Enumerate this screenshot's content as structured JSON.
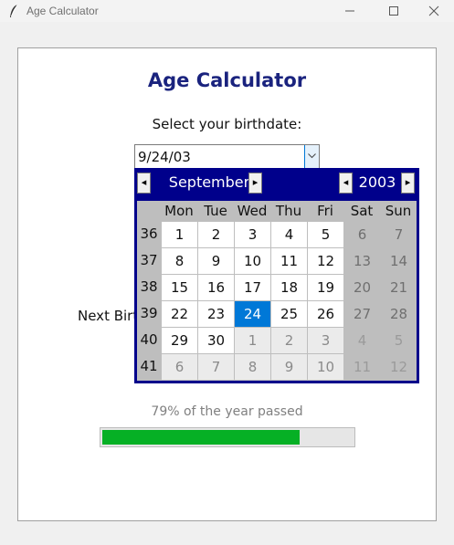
{
  "window": {
    "title": "Age Calculator",
    "app_icon": "feather-icon",
    "controls": [
      "minimize-icon",
      "maximize-icon",
      "close-icon"
    ]
  },
  "heading": "Age Calculator",
  "select_label": "Select your birthdate:",
  "date_entry": {
    "value": "9/24/03",
    "dropdown_icon": "chevron-down-icon"
  },
  "next_birthday_label": "Next Birth",
  "calendar": {
    "month": "September",
    "year": "2003",
    "prev_month": "◂",
    "next_month": "▸",
    "prev_year": "◂",
    "next_year": "▸",
    "weekdays": [
      "Mon",
      "Tue",
      "Wed",
      "Thu",
      "Fri",
      "Sat",
      "Sun"
    ],
    "weeks": [
      {
        "num": "36",
        "days": [
          "1",
          "2",
          "3",
          "4",
          "5",
          "6",
          "7"
        ]
      },
      {
        "num": "37",
        "days": [
          "8",
          "9",
          "10",
          "11",
          "12",
          "13",
          "14"
        ]
      },
      {
        "num": "38",
        "days": [
          "15",
          "16",
          "17",
          "18",
          "19",
          "20",
          "21"
        ]
      },
      {
        "num": "39",
        "days": [
          "22",
          "23",
          "24",
          "25",
          "26",
          "27",
          "28"
        ]
      },
      {
        "num": "40",
        "days": [
          "29",
          "30",
          "1",
          "2",
          "3",
          "4",
          "5"
        ]
      },
      {
        "num": "41",
        "days": [
          "6",
          "7",
          "8",
          "9",
          "10",
          "11",
          "12"
        ]
      }
    ],
    "selected_day": "24",
    "colors": {
      "header_bg": "#00008b",
      "selected_bg": "#0078d7",
      "weekend_bg": "#bebebe"
    }
  },
  "progress": {
    "label": "79% of the year passed",
    "value": 0.79,
    "color": "#06b025"
  }
}
